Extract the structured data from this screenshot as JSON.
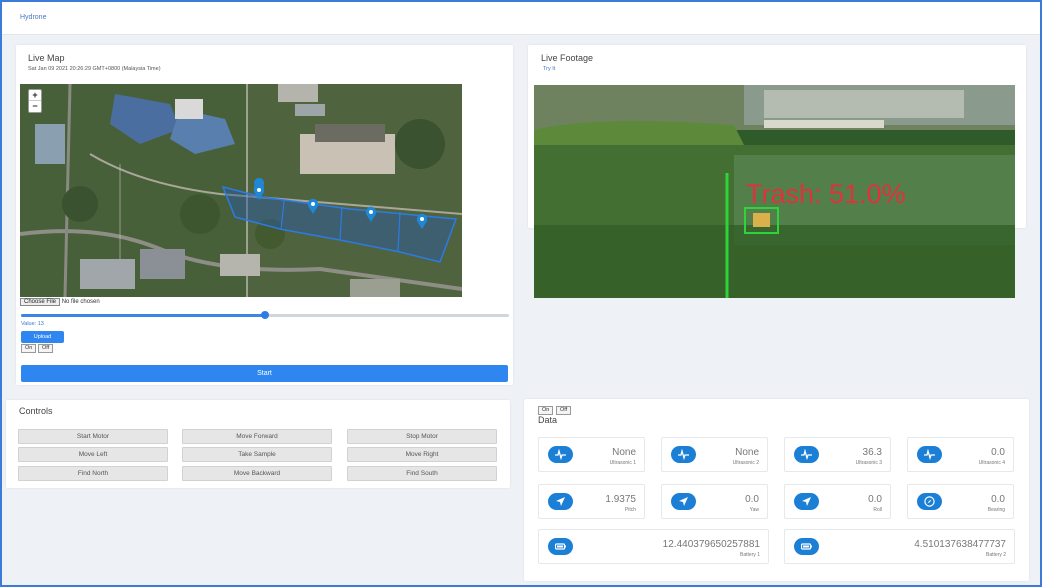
{
  "app": {
    "brand": "Hydrone"
  },
  "map_card": {
    "title": "Live Map",
    "timestamp": "Sat Jan 09 2021 20:26:29 GMT+0800 (Malaysia Time)",
    "zoom_in": "+",
    "zoom_out": "−",
    "markers": 4,
    "file_button": "Choose File",
    "file_status": "No file chosen",
    "slider_value_fraction": 0.5,
    "value_label": "Value: 13",
    "upload_label": "Upload",
    "on_label": "On",
    "off_label": "Off",
    "start_label": "Start"
  },
  "footage_card": {
    "title": "Live Footage",
    "try_link": "Try It",
    "detection_label": "Trash: 51.0%",
    "detection_color": "#e0323c",
    "guide_color": "#2fd33a"
  },
  "controls": {
    "title": "Controls",
    "buttons": [
      [
        "Start Motor",
        "Move Forward",
        "Stop Motor"
      ],
      [
        "Move Left",
        "Take Sample",
        "Move Right"
      ],
      [
        "Find North",
        "Move Backward",
        "Find South"
      ]
    ]
  },
  "data": {
    "on_label": "On",
    "off_label": "Off",
    "title": "Data",
    "accent": "#1c7fd6",
    "tiles": [
      {
        "value": "None",
        "label": "Ultrasonic 1",
        "icon": "pulse-icon"
      },
      {
        "value": "None",
        "label": "Ultrasonic 2",
        "icon": "pulse-icon"
      },
      {
        "value": "36.3",
        "label": "Ultrasonic 3",
        "icon": "pulse-icon"
      },
      {
        "value": "0.0",
        "label": "Ultrasonic 4",
        "icon": "pulse-icon"
      },
      {
        "value": "1.9375",
        "label": "Pitch",
        "icon": "navigation-arrow-icon"
      },
      {
        "value": "0.0",
        "label": "Yaw",
        "icon": "navigation-arrow-icon"
      },
      {
        "value": "0.0",
        "label": "Roll",
        "icon": "navigation-arrow-icon"
      },
      {
        "value": "0.0",
        "label": "Bearing",
        "icon": "compass-icon"
      },
      {
        "value": "12.440379650257881",
        "label": "Battery 1",
        "icon": "battery-icon"
      },
      {
        "value": "4.510137638477737",
        "label": "Battery 2",
        "icon": "battery-icon"
      }
    ]
  }
}
